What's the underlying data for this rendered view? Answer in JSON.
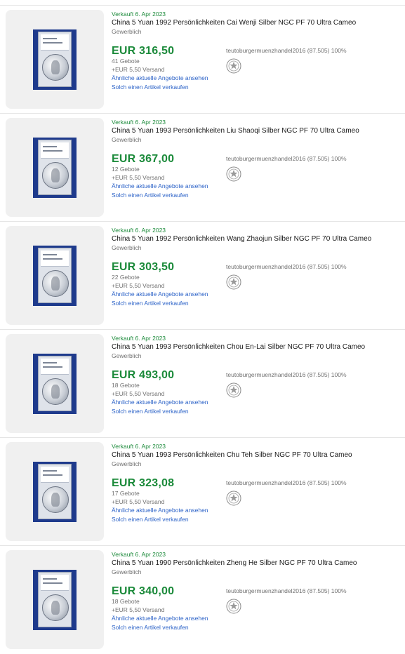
{
  "listings": [
    {
      "sold_date": "Verkauft 6. Apr 2023",
      "title": "China 5 Yuan 1992 Persönlichkeiten Cai Wenji Silber NGC PF 70 Ultra Cameo",
      "condition": "Gewerblich",
      "price": "EUR 316,50",
      "bids": "41 Gebote",
      "shipping": "+EUR 5,50 Versand",
      "similar_link": "Ähnliche aktuelle Angebote ansehen",
      "sell_link": "Solch einen Artikel verkaufen",
      "seller": "teutoburgermuenzhandel2016 (87.505) 100%"
    },
    {
      "sold_date": "Verkauft 6. Apr 2023",
      "title": "China 5 Yuan 1993 Persönlichkeiten Liu Shaoqi Silber NGC PF 70 Ultra Cameo",
      "condition": "Gewerblich",
      "price": "EUR 367,00",
      "bids": "12 Gebote",
      "shipping": "+EUR 5,50 Versand",
      "similar_link": "Ähnliche aktuelle Angebote ansehen",
      "sell_link": "Solch einen Artikel verkaufen",
      "seller": "teutoburgermuenzhandel2016 (87.505) 100%"
    },
    {
      "sold_date": "Verkauft 6. Apr 2023",
      "title": "China 5 Yuan 1992 Persönlichkeiten Wang Zhaojun Silber NGC PF 70 Ultra Cameo",
      "condition": "Gewerblich",
      "price": "EUR 303,50",
      "bids": "22 Gebote",
      "shipping": "+EUR 5,50 Versand",
      "similar_link": "Ähnliche aktuelle Angebote ansehen",
      "sell_link": "Solch einen Artikel verkaufen",
      "seller": "teutoburgermuenzhandel2016 (87.505) 100%"
    },
    {
      "sold_date": "Verkauft 6. Apr 2023",
      "title": "China 5 Yuan 1993 Persönlichkeiten Chou En-Lai Silber NGC PF 70 Ultra Cameo",
      "condition": "Gewerblich",
      "price": "EUR 493,00",
      "bids": "18 Gebote",
      "shipping": "+EUR 5,50 Versand",
      "similar_link": "Ähnliche aktuelle Angebote ansehen",
      "sell_link": "Solch einen Artikel verkaufen",
      "seller": "teutoburgermuenzhandel2016 (87.505) 100%"
    },
    {
      "sold_date": "Verkauft 6. Apr 2023",
      "title": "China 5 Yuan 1993 Persönlichkeiten Chu Teh Silber NGC PF 70 Ultra Cameo",
      "condition": "Gewerblich",
      "price": "EUR 323,08",
      "bids": "17 Gebote",
      "shipping": "+EUR 5,50 Versand",
      "similar_link": "Ähnliche aktuelle Angebote ansehen",
      "sell_link": "Solch einen Artikel verkaufen",
      "seller": "teutoburgermuenzhandel2016 (87.505) 100%"
    },
    {
      "sold_date": "Verkauft 6. Apr 2023",
      "title": "China 5 Yuan 1990 Persönlichkeiten Zheng He Silber NGC PF 70 Ultra Cameo",
      "condition": "Gewerblich",
      "price": "EUR 340,00",
      "bids": "18 Gebote",
      "shipping": "+EUR 5,50 Versand",
      "similar_link": "Ähnliche aktuelle Angebote ansehen",
      "sell_link": "Solch einen Artikel verkaufen",
      "seller": "teutoburgermuenzhandel2016 (87.505) 100%"
    }
  ],
  "colors": {
    "sold_green": "#1b8a3a",
    "link_blue": "#2a61c7",
    "muted_text": "#707070",
    "thumb_bg": "#f0f0f0",
    "slab_blue": "#1e3a8c"
  },
  "icons": {
    "seller_badge": "seller-badge-icon",
    "coin_photo": "coin-slab-image"
  }
}
